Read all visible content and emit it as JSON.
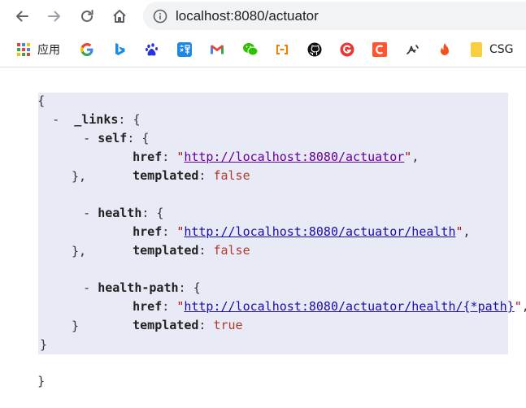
{
  "browser": {
    "url": "localhost:8080/actuator"
  },
  "bookmarks": {
    "apps_label": "应用",
    "last_label": "CSG"
  },
  "json": {
    "open_brace": "{",
    "close_brace": "}",
    "links_key": "_links",
    "self_key": "self",
    "health_key": "health",
    "health_path_key": "health-path",
    "href_key": "href",
    "templated_key": "templated",
    "self_href": "http://localhost:8080/actuator",
    "self_templated": "false",
    "health_href": "http://localhost:8080/actuator/health",
    "health_templated": "false",
    "health_path_href": "http://localhost:8080/actuator/health/{*path}",
    "health_path_templated": "true",
    "toggle": "-"
  }
}
